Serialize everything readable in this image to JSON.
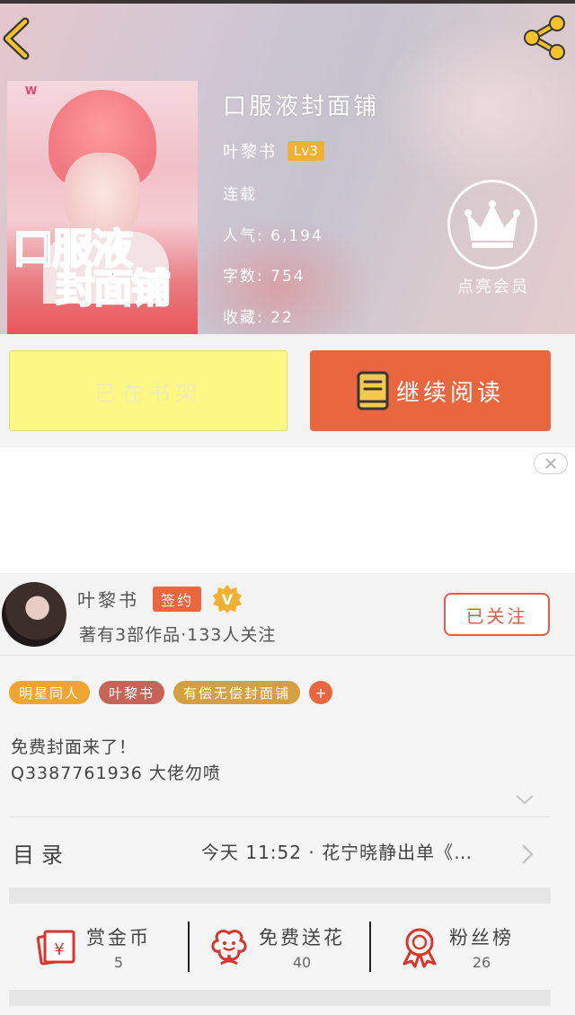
{
  "book": {
    "title": "口服液封面铺",
    "author": "叶黎书",
    "level": "Lv3",
    "status": "连载",
    "popularity": "人气: 6,194",
    "word_count": "字数: 754",
    "favorites": "收藏: 22",
    "cover_text_line1": "口服液",
    "cover_text_line2": "封面铺"
  },
  "vip": {
    "label": "点亮会员"
  },
  "actions": {
    "shelf_label": "已在书架",
    "read_label": "继续阅读"
  },
  "author_info": {
    "name": "叶黎书",
    "signed_badge": "签约",
    "verified_badge": "V",
    "stats": "著有3部作品·133人关注",
    "follow_label": "已关注"
  },
  "tags": [
    "明星同人",
    "叶黎书",
    "有偿无偿封面铺"
  ],
  "tag_add": "+",
  "description": {
    "line1": "免费封面来了！",
    "line2": "Q3387761936 大佬勿喷"
  },
  "toc": {
    "label": "目录",
    "latest": "今天 11:52 · 花宁晓静出单《…"
  },
  "rewards": [
    {
      "label": "赏金币",
      "count": "5",
      "icon": "red-envelope-icon"
    },
    {
      "label": "免费送花",
      "count": "40",
      "icon": "flower-icon"
    },
    {
      "label": "粉丝榜",
      "count": "26",
      "icon": "medal-icon"
    }
  ],
  "colors": {
    "accent_orange": "#e9663f",
    "shelf_yellow": "#fdf783",
    "tag_orange": "#f0a431",
    "tag_brown": "#c66557",
    "tag_gold": "#d5a041",
    "badge_gold": "#f0b133"
  }
}
